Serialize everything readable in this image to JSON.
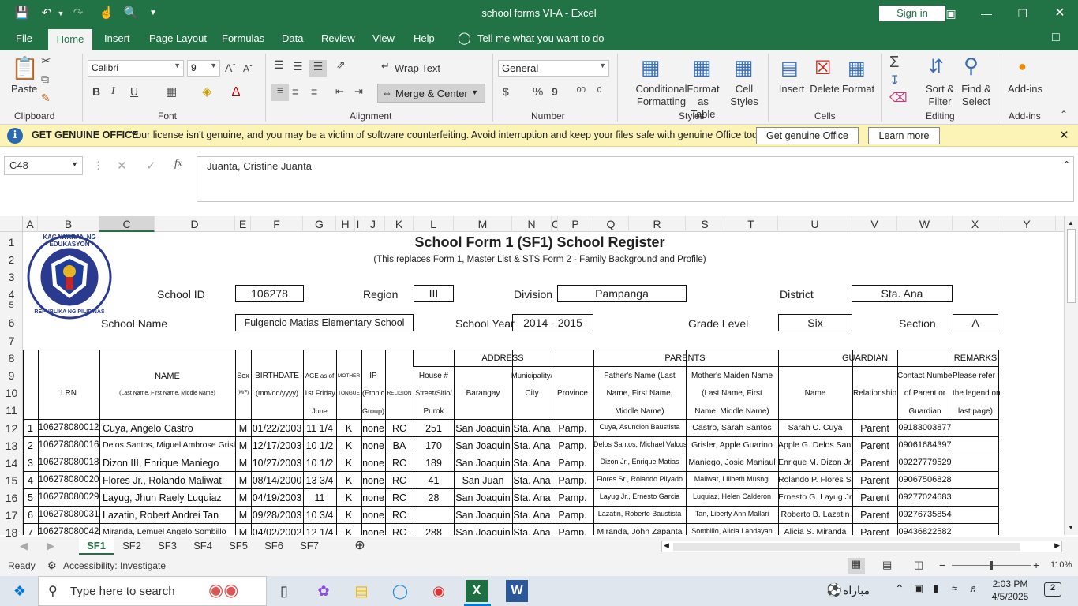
{
  "window": {
    "title": "school forms VI-A  -  Excel",
    "signin": "Sign in"
  },
  "menu": [
    "File",
    "Home",
    "Insert",
    "Page Layout",
    "Formulas",
    "Data",
    "Review",
    "View",
    "Help"
  ],
  "tellme": "Tell me what you want to do",
  "ribbon": {
    "font_name": "Calibri",
    "font_size": "9",
    "number_format": "General",
    "paste": "Paste",
    "wrap": "Wrap Text",
    "merge": "Merge & Center",
    "cond": [
      "Conditional",
      "Formatting"
    ],
    "fmt_table": [
      "Format as",
      "Table"
    ],
    "cell_styles": [
      "Cell",
      "Styles"
    ],
    "insert": "Insert",
    "delete": "Delete",
    "format": "Format",
    "sort": [
      "Sort &",
      "Filter"
    ],
    "find": [
      "Find &",
      "Select"
    ],
    "addins": "Add-ins",
    "groups": [
      "Clipboard",
      "Font",
      "Alignment",
      "Number",
      "Styles",
      "Cells",
      "Editing",
      "Add-ins"
    ]
  },
  "notice": {
    "title": "GET GENUINE OFFICE",
    "text": "Your license isn't genuine, and you may be a victim of software counterfeiting. Avoid interruption and keep your files safe with genuine Office today.",
    "btn1": "Get genuine Office",
    "btn2": "Learn more"
  },
  "namebox": "C48",
  "formula": "Juanta, Cristine Juanta",
  "columns": [
    "A",
    "B",
    "C",
    "D",
    "E",
    "F",
    "G",
    "H",
    "I",
    "J",
    "K",
    "L",
    "M",
    "N",
    "O",
    "P",
    "Q",
    "R",
    "S",
    "T",
    "U",
    "V",
    "W",
    "X",
    "Y"
  ],
  "rows": [
    "1",
    "2",
    "3",
    "4",
    "5",
    "6",
    "7",
    "8",
    "9",
    "10",
    "11",
    "12",
    "13",
    "14",
    "15",
    "16",
    "17",
    "18"
  ],
  "form": {
    "title": "School Form 1 (SF1) School Register",
    "subtitle": "(This replaces Form 1, Master List & STS Form 2 - Family Background and Profile)",
    "school_id_lbl": "School ID",
    "school_id": "106278",
    "region_lbl": "Region",
    "region": "III",
    "division_lbl": "Division",
    "division": "Pampanga",
    "district_lbl": "District",
    "district": "Sta. Ana",
    "school_name_lbl": "School Name",
    "school_name": "Fulgencio Matias Elementary School",
    "school_year_lbl": "School Year",
    "school_year": "2014  - 2015",
    "grade_lbl": "Grade Level",
    "grade": "Six",
    "section_lbl": "Section",
    "section": "A",
    "logo_top": "KAGAWARAN NG EDUKASYON",
    "logo_bottom": "REPUBLIKA NG PILIPINAS"
  },
  "headers": {
    "address": "ADDRESS",
    "parents": "PARENTS",
    "guardian": "GUARDIAN",
    "remarks": "REMARKS",
    "lrn": "LRN",
    "name": "NAME",
    "name_sub": "(Last Name, First Name, Middle Name)",
    "sex": "Sex",
    "sex_sub": "(M/F)",
    "bday": "BIRTHDATE",
    "bday_sub": "(mm/dd/yyyy)",
    "age1": "AGE as of",
    "age2": "1st Friday",
    "age3": "June",
    "mt1": "MOTHER",
    "mt2": "TONGUE",
    "ip1": "IP",
    "ip2": "(Ethnic",
    "ip3": "Group)",
    "religion": "RELIGION",
    "house1": "House #",
    "house2": "Street/Sitio/",
    "house3": "Purok",
    "barangay": "Barangay",
    "muni1": "Municipality/",
    "muni2": "City",
    "province": "Province",
    "father1": "Father's Name (Last",
    "father2": "Name, First Name,",
    "father3": "Middle Name)",
    "mother1": "Mother's Maiden Name",
    "mother2": "(Last Name, First",
    "mother3": "Name, Middle Name)",
    "gname": "Name",
    "relationship": "Relationship",
    "contact1": "Contact Number",
    "contact2": "of Parent or",
    "contact3": "Guardian",
    "rem1": "Please refer to",
    "rem2": "the legend on",
    "rem3": "last page)"
  },
  "students": [
    {
      "no": "1",
      "lrn": "106278080012",
      "name": "Cuya, Angelo Castro",
      "sex": "M",
      "bday": "01/22/2003",
      "age": "11 1/4",
      "mt": "K",
      "ip": "none",
      "rel": "RC",
      "house": "251",
      "brgy": "San Joaquin",
      "city": "Sta. Ana",
      "prov": "Pamp.",
      "father": "Cuya, Asuncion Baustista",
      "mother": "Castro, Sarah Santos",
      "guardian": "Sarah C. Cuya",
      "relation": "Parent",
      "contact": "09183003877"
    },
    {
      "no": "2",
      "lrn": "106278080016",
      "name": "Delos Santos, Miguel Ambrose Grisler",
      "sex": "M",
      "bday": "12/17/2003",
      "age": "10 1/2",
      "mt": "K",
      "ip": "none",
      "rel": "BA",
      "house": "170",
      "brgy": "San Joaquin",
      "city": "Sta. Ana",
      "prov": "Pamp.",
      "father": "Delos Santos, Michael Valcos",
      "mother": "Grisler, Apple Guarino",
      "guardian": "Apple G. Delos Santos",
      "relation": "Parent",
      "contact": "09061684397"
    },
    {
      "no": "3",
      "lrn": "106278080018",
      "name": "Dizon III, Enrique Maniego",
      "sex": "M",
      "bday": "10/27/2003",
      "age": "10 1/2",
      "mt": "K",
      "ip": "none",
      "rel": "RC",
      "house": "189",
      "brgy": "San Joaquin",
      "city": "Sta. Ana",
      "prov": "Pamp.",
      "father": "Dizon Jr., Enrique Matias",
      "mother": "Maniego, Josie Maniaul",
      "guardian": "Enrique M. Dizon Jr.",
      "relation": "Parent",
      "contact": "09227779529"
    },
    {
      "no": "4",
      "lrn": "106278080020",
      "name": "Flores Jr., Rolando Maliwat",
      "sex": "M",
      "bday": "08/14/2000",
      "age": "13 3/4",
      "mt": "K",
      "ip": "none",
      "rel": "RC",
      "house": "41",
      "brgy": "San Juan",
      "city": "Sta. Ana",
      "prov": "Pamp.",
      "father": "Flores Sr., Rolando Pilyado",
      "mother": "Maliwat, Lilibeth Musngi",
      "guardian": "Rolando P. Flores Sr.",
      "relation": "Parent",
      "contact": "09067506828"
    },
    {
      "no": "5",
      "lrn": "106278080029",
      "name": "Layug, Jhun Raely Luquiaz",
      "sex": "M",
      "bday": "04/19/2003",
      "age": "11",
      "mt": "K",
      "ip": "none",
      "rel": "RC",
      "house": "28",
      "brgy": "San Joaquin",
      "city": "Sta. Ana",
      "prov": "Pamp.",
      "father": "Layug Jr., Ernesto Garcia",
      "mother": "Luquiaz, Helen Calderon",
      "guardian": "Ernesto G. Layug Jr.",
      "relation": "Parent",
      "contact": "09277024683"
    },
    {
      "no": "6",
      "lrn": "106278080031",
      "name": "Lazatin, Robert Andrei Tan",
      "sex": "M",
      "bday": "09/28/2003",
      "age": "10 3/4",
      "mt": "K",
      "ip": "none",
      "rel": "RC",
      "house": "",
      "brgy": "San Joaquin",
      "city": "Sta. Ana",
      "prov": "Pamp.",
      "father": "Lazatin, Roberto Baustista",
      "mother": "Tan, Liberty Ann Mallari",
      "guardian": "Roberto B. Lazatin",
      "relation": "Parent",
      "contact": "09276735854"
    },
    {
      "no": "7",
      "lrn": "106278080042",
      "name": "Miranda, Lemuel Angelo Sombillo",
      "sex": "M",
      "bday": "04/02/2002",
      "age": "12 1/4",
      "mt": "K",
      "ip": "none",
      "rel": "RC",
      "house": "288",
      "brgy": "San Joaquin",
      "city": "Sta. Ana",
      "prov": "Pamp.",
      "father": "Miranda, John Zapanta",
      "mother": "Sombillo, Alicia Landayan",
      "guardian": "Alicia S. Miranda",
      "relation": "Parent",
      "contact": "09436822582"
    }
  ],
  "sheets": [
    "SF1",
    "SF2",
    "SF3",
    "SF4",
    "SF5",
    "SF6",
    "SF7"
  ],
  "status": {
    "ready": "Ready",
    "access": "Accessibility: Investigate",
    "zoom": "110%"
  },
  "taskbar": {
    "search": "Type here to search",
    "weather": "مباراة",
    "time": "2:03 PM",
    "date": "4/5/2025",
    "notif": "2"
  }
}
